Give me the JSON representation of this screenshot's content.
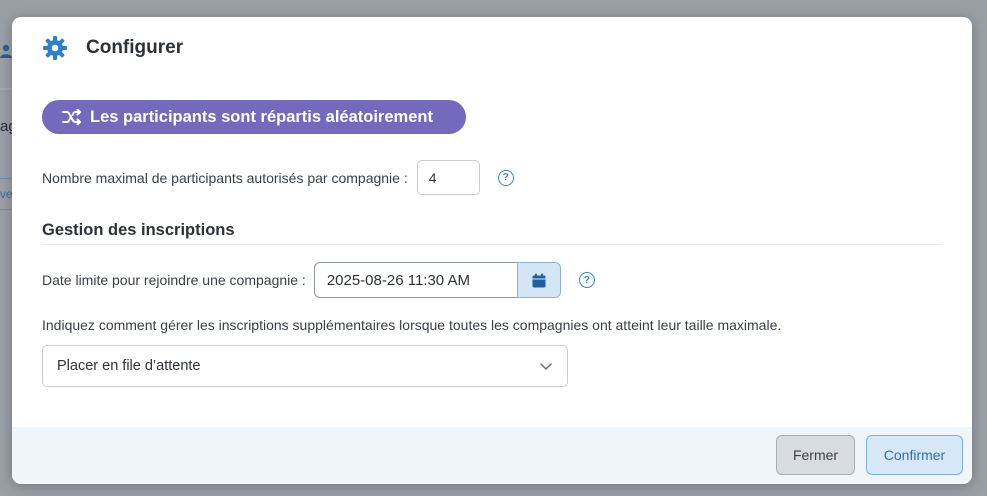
{
  "background": {
    "text_fragment": "ag",
    "button_fragment": "ve"
  },
  "dialog": {
    "title": "Configurer",
    "icon": "gear-icon",
    "random_badge": {
      "label": "Les participants sont répartis aléatoirement",
      "icon": "shuffle-icon",
      "color": "#7469bd"
    },
    "max_participants": {
      "label": "Nombre maximal de participants autorisés par compagnie :",
      "value": "4",
      "help_icon": "question-circle-icon"
    },
    "registration_section": {
      "title": "Gestion des inscriptions",
      "deadline": {
        "label": "Date limite pour rejoindre une compagnie :",
        "value": "2025-08-26 11:30 AM",
        "button_icon": "calendar-icon",
        "help_icon": "question-circle-icon"
      },
      "overflow_instruction": "Indiquez comment gérer les inscriptions supplémentaires lorsque toutes les compagnies ont atteint leur taille maximale.",
      "overflow_select": {
        "selected": "Placer en file d’attente",
        "icon": "chevron-down-icon"
      }
    },
    "footer": {
      "close_label": "Fermer",
      "confirm_label": "Confirmer"
    }
  },
  "colors": {
    "accent": "#3a86c8",
    "badge": "#7469bd",
    "footer_bg": "#f0f5fa"
  }
}
